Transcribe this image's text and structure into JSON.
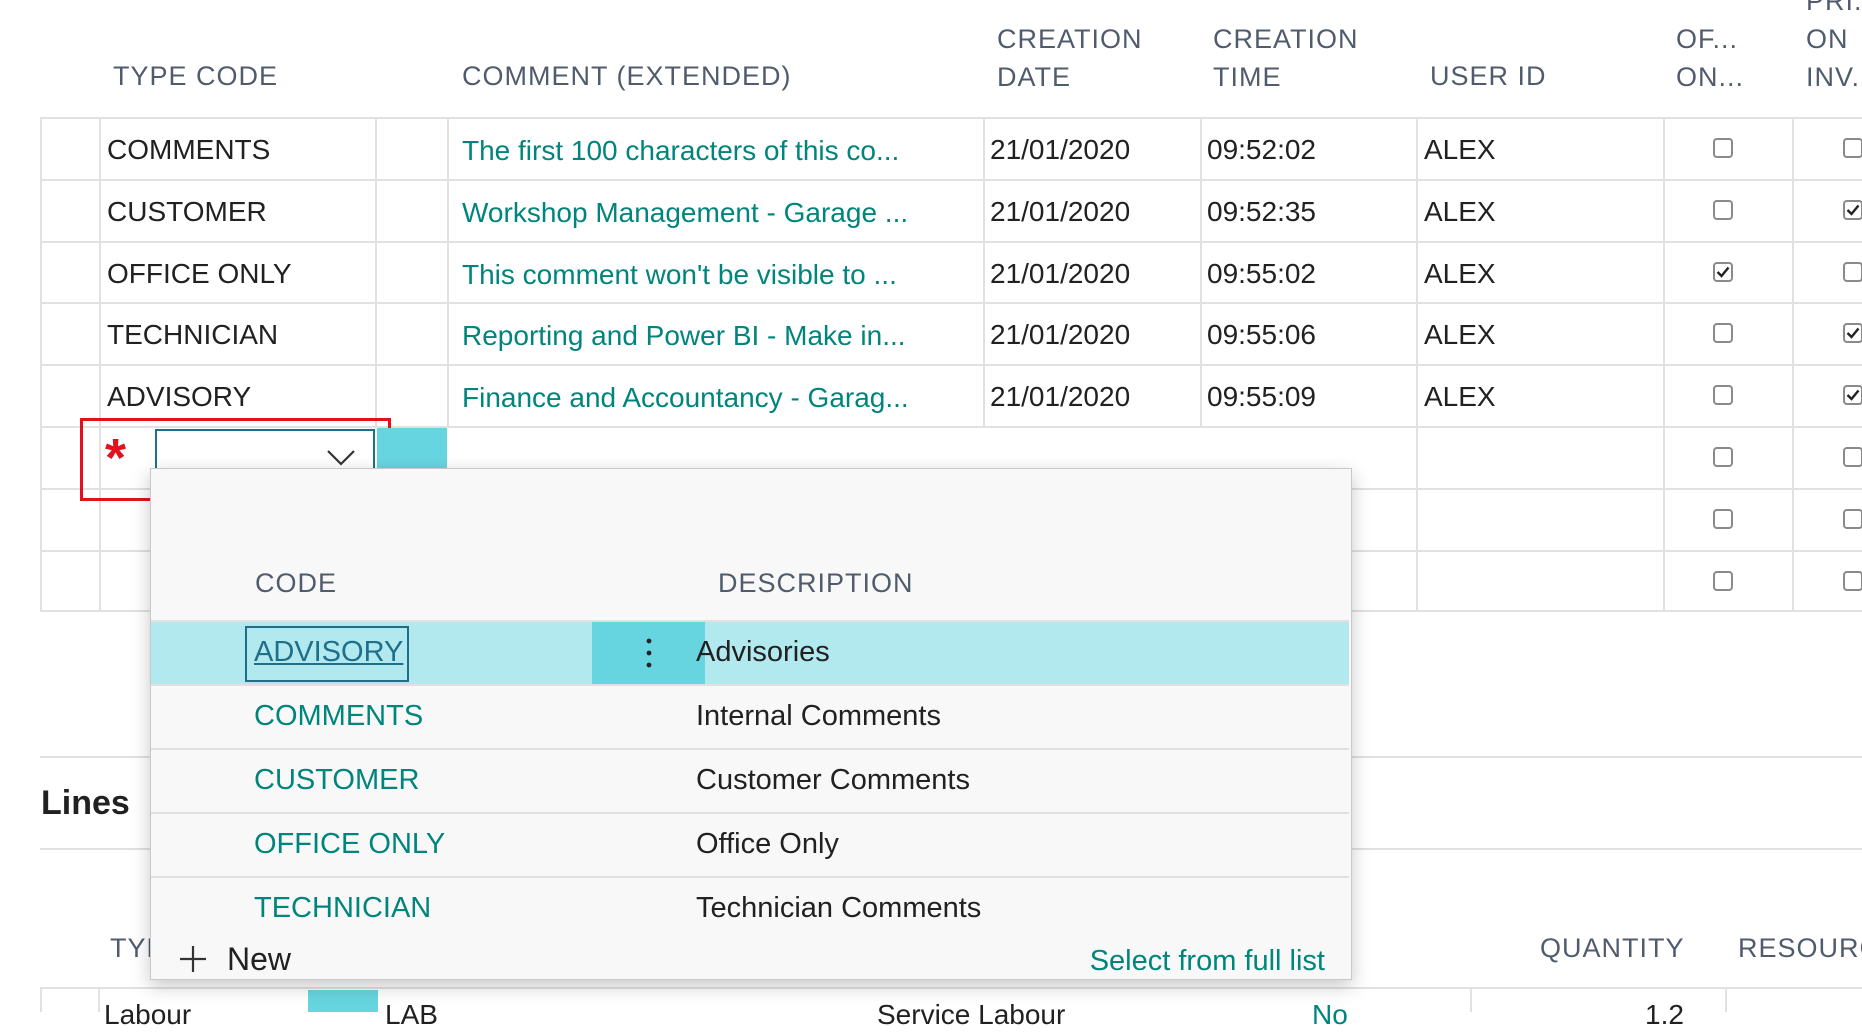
{
  "grid": {
    "headers": {
      "type_code": "TYPE CODE",
      "comment": "COMMENT (EXTENDED)",
      "creation_date_1": "CREATION",
      "creation_date_2": "DATE",
      "creation_time_1": "CREATION",
      "creation_time_2": "TIME",
      "user_id": "USER ID",
      "office_only_1": "OF...",
      "office_only_2": "ON...",
      "print_on_inv_1": "PRI...",
      "print_on_inv_2": "ON",
      "print_on_inv_3": "INV..."
    },
    "rows": [
      {
        "type_code": "COMMENTS",
        "comment": "The first 100 characters of this co...",
        "date": "21/01/2020",
        "time": "09:52:02",
        "user": "ALEX",
        "office_only": false,
        "print_on_inv": false
      },
      {
        "type_code": "CUSTOMER",
        "comment": "Workshop Management - Garage ...",
        "date": "21/01/2020",
        "time": "09:52:35",
        "user": "ALEX",
        "office_only": false,
        "print_on_inv": true
      },
      {
        "type_code": "OFFICE ONLY",
        "comment": "This comment won't be visible to ...",
        "date": "21/01/2020",
        "time": "09:55:02",
        "user": "ALEX",
        "office_only": true,
        "print_on_inv": false
      },
      {
        "type_code": "TECHNICIAN",
        "comment": "Reporting and Power BI - Make in...",
        "date": "21/01/2020",
        "time": "09:55:06",
        "user": "ALEX",
        "office_only": false,
        "print_on_inv": true
      },
      {
        "type_code": "ADVISORY",
        "comment": "Finance and Accountancy - Garag...",
        "date": "21/01/2020",
        "time": "09:55:09",
        "user": "ALEX",
        "office_only": false,
        "print_on_inv": true
      }
    ],
    "required_marker": "*",
    "type_code_input_value": ""
  },
  "lookup": {
    "headers": {
      "code": "CODE",
      "description": "DESCRIPTION"
    },
    "items": [
      {
        "code": "ADVISORY",
        "description": "Advisories",
        "selected": true
      },
      {
        "code": "COMMENTS",
        "description": "Internal Comments"
      },
      {
        "code": "CUSTOMER",
        "description": "Customer Comments"
      },
      {
        "code": "OFFICE ONLY",
        "description": "Office Only"
      },
      {
        "code": "TECHNICIAN",
        "description": "Technician Comments"
      }
    ],
    "new_label": "New",
    "full_list_label": "Select from full list"
  },
  "lines": {
    "title": "Lines",
    "headers": {
      "type": "TYP",
      "quantity": "QUANTITY",
      "resources": "RESOURCES"
    },
    "row": {
      "type": "Labour",
      "code": "LAB",
      "description": "Service Labour",
      "no": "No",
      "quantity": "1.2"
    }
  },
  "colors": {
    "accent": "#00857d",
    "selection": "#b1e9ef",
    "selection_dark": "#67d5e0",
    "highlight_border": "#e3101e"
  }
}
